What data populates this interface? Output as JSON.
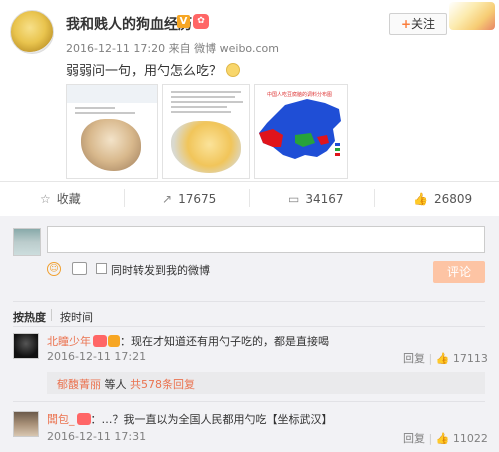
{
  "post": {
    "username": "我和贱人的狗血经历",
    "verified_badge": "V",
    "time": "2016-12-11 17:20",
    "source_prefix": "来自",
    "source": "微博 weibo.com",
    "text": "弱弱问一句，用勺怎么吃？",
    "follow_label": "关注",
    "follow_plus": "+"
  },
  "images": {
    "map_title": "中国人吃豆腐脑的调料分布图"
  },
  "actions": {
    "favorite": {
      "icon": "star-icon",
      "label": "收藏"
    },
    "forward": {
      "icon": "share-icon",
      "label": "17675"
    },
    "comment": {
      "icon": "comment-icon",
      "label": "34167"
    },
    "like": {
      "icon": "thumbs-up-icon",
      "label": "26809"
    }
  },
  "composer": {
    "placeholder": "",
    "checkbox_label": "同时转发到我的微博",
    "submit_label": "评论"
  },
  "sort_tabs": [
    "按热度",
    "按时间"
  ],
  "comments": [
    {
      "name": "北瞳少年",
      "text": "：现在才知道还有用勺子吃的，都是直接喝",
      "time": "2016-12-11 17:21",
      "reply_label": "回复",
      "likes": "17113"
    },
    {
      "name": "闆包_",
      "text": "：…？我一直以为全国人民都用勺吃【坐标武汉】",
      "time": "2016-12-11 17:31",
      "reply_label": "回复",
      "likes": "11022"
    }
  ],
  "reply_summary": {
    "name": "郁馥菁丽",
    "middle": "等人",
    "count": "共578条回复"
  },
  "colors": {
    "accent": "#eb7350",
    "submit": "#fdc4a4",
    "comment_bg": "#f2f2f5"
  }
}
